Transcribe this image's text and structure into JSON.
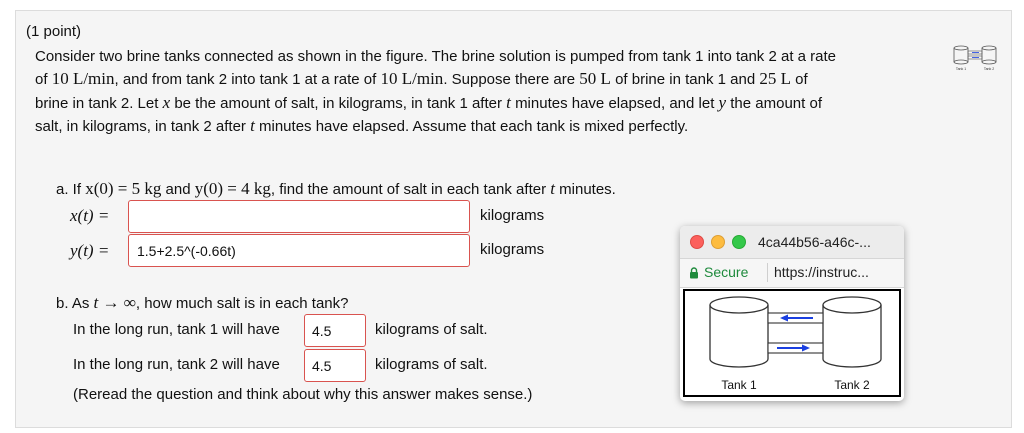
{
  "problem": {
    "points": "(1 point)",
    "p1a": "Consider two brine tanks connected as shown in the figure. The brine solution is pumped from tank 1 into tank 2 at a rate",
    "p2": {
      "of": "of",
      "rate1": "10 L/min",
      "mid1": ", and from tank 2 into tank 1 at a rate of",
      "rate2": "10 L/min",
      "mid2": ". Suppose there are",
      "vol1": "50 L",
      "mid3": "of brine in tank 1 and",
      "vol2": "25 L",
      "end": "of"
    },
    "p3": {
      "a": "brine in tank 2. Let",
      "x": "x",
      "b": "be the amount of salt, in kilograms, in tank 1 after",
      "t": "t",
      "c": "minutes have elapsed, and let",
      "y": "y",
      "d": "the amount of"
    },
    "p4": {
      "a": "salt, in kilograms, in tank 2 after",
      "t": "t",
      "b": "minutes have elapsed. Assume that each tank is mixed perfectly."
    }
  },
  "part_a": {
    "prefix": "a. If",
    "cond_x": "x(0) = 5 kg",
    "and": "and",
    "cond_y": "y(0) = 4 kg",
    "rest": ", find the amount of salt in each tank after",
    "t": "t",
    "minutes": "minutes.",
    "x_label": "x(t) =",
    "x_value": "",
    "x_unit": "kilograms",
    "y_label": "y(t) =",
    "y_value": "1.5+2.5^(-0.66t)",
    "y_unit": "kilograms"
  },
  "part_b": {
    "q_prefix": "b. As",
    "q_limit": "t → ∞",
    "q_rest": ", how much salt is in each tank?",
    "line1_prefix": "In the long run, tank 1 will have",
    "tank1_value": "4.5",
    "line1_suffix": "kilograms of salt.",
    "line2_prefix": "In the long run, tank 2 will have",
    "tank2_value": "4.5",
    "line2_suffix": "kilograms of salt.",
    "note": "(Reread the question and think about why this answer makes sense.)"
  },
  "popup": {
    "title": "4ca44b56-a46c-...",
    "secure": "Secure",
    "url": "https://instruc...",
    "tank1": "Tank 1",
    "tank2": "Tank 2"
  },
  "thumbnail": {
    "tank1": "Tank 1",
    "tank2": "Tank 2"
  },
  "colors": {
    "input_border": "#d9534f",
    "arrow": "#1a3fe0",
    "secure": "#1e8a3c"
  }
}
